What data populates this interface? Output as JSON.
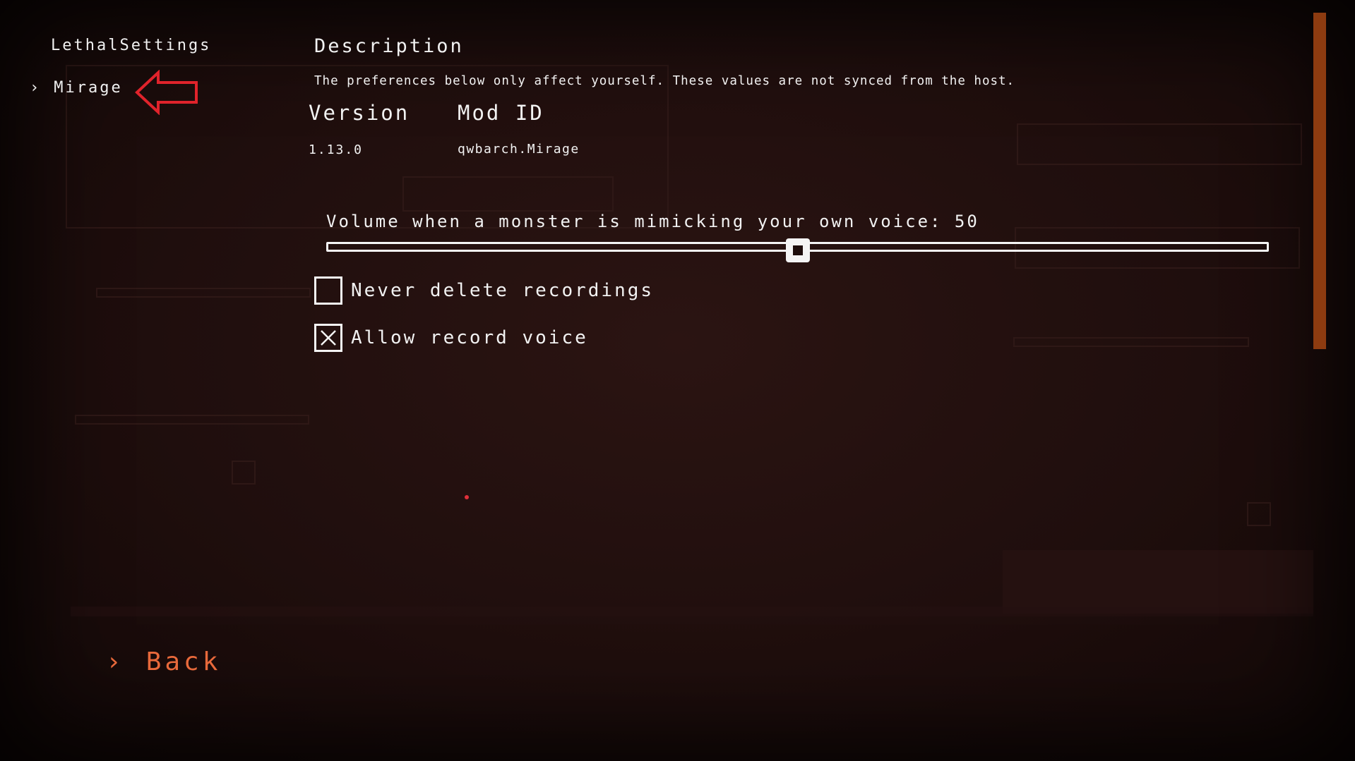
{
  "nav": {
    "title": "LethalSettings",
    "items": [
      {
        "label": "Mirage",
        "icon": "chevron-right-icon"
      }
    ]
  },
  "main": {
    "description_title": "Description",
    "description_text": "The preferences below only affect yourself. These values are not synced from the host.",
    "version_label": "Version",
    "version_value": "1.13.0",
    "modid_label": "Mod ID",
    "modid_value": "qwbarch.Mirage",
    "slider": {
      "label": "Volume when a monster is mimicking your own voice: 50",
      "value": 50,
      "min": 0,
      "max": 100
    },
    "checkboxes": [
      {
        "label": "Never delete recordings",
        "checked": false
      },
      {
        "label": "Allow record voice",
        "checked": true
      }
    ]
  },
  "back_label": "Back",
  "colors": {
    "background": "#1d0d0c",
    "accent": "#e8693b",
    "scrollbar": "#8d3b10",
    "annotation_arrow": "#e0232b"
  }
}
